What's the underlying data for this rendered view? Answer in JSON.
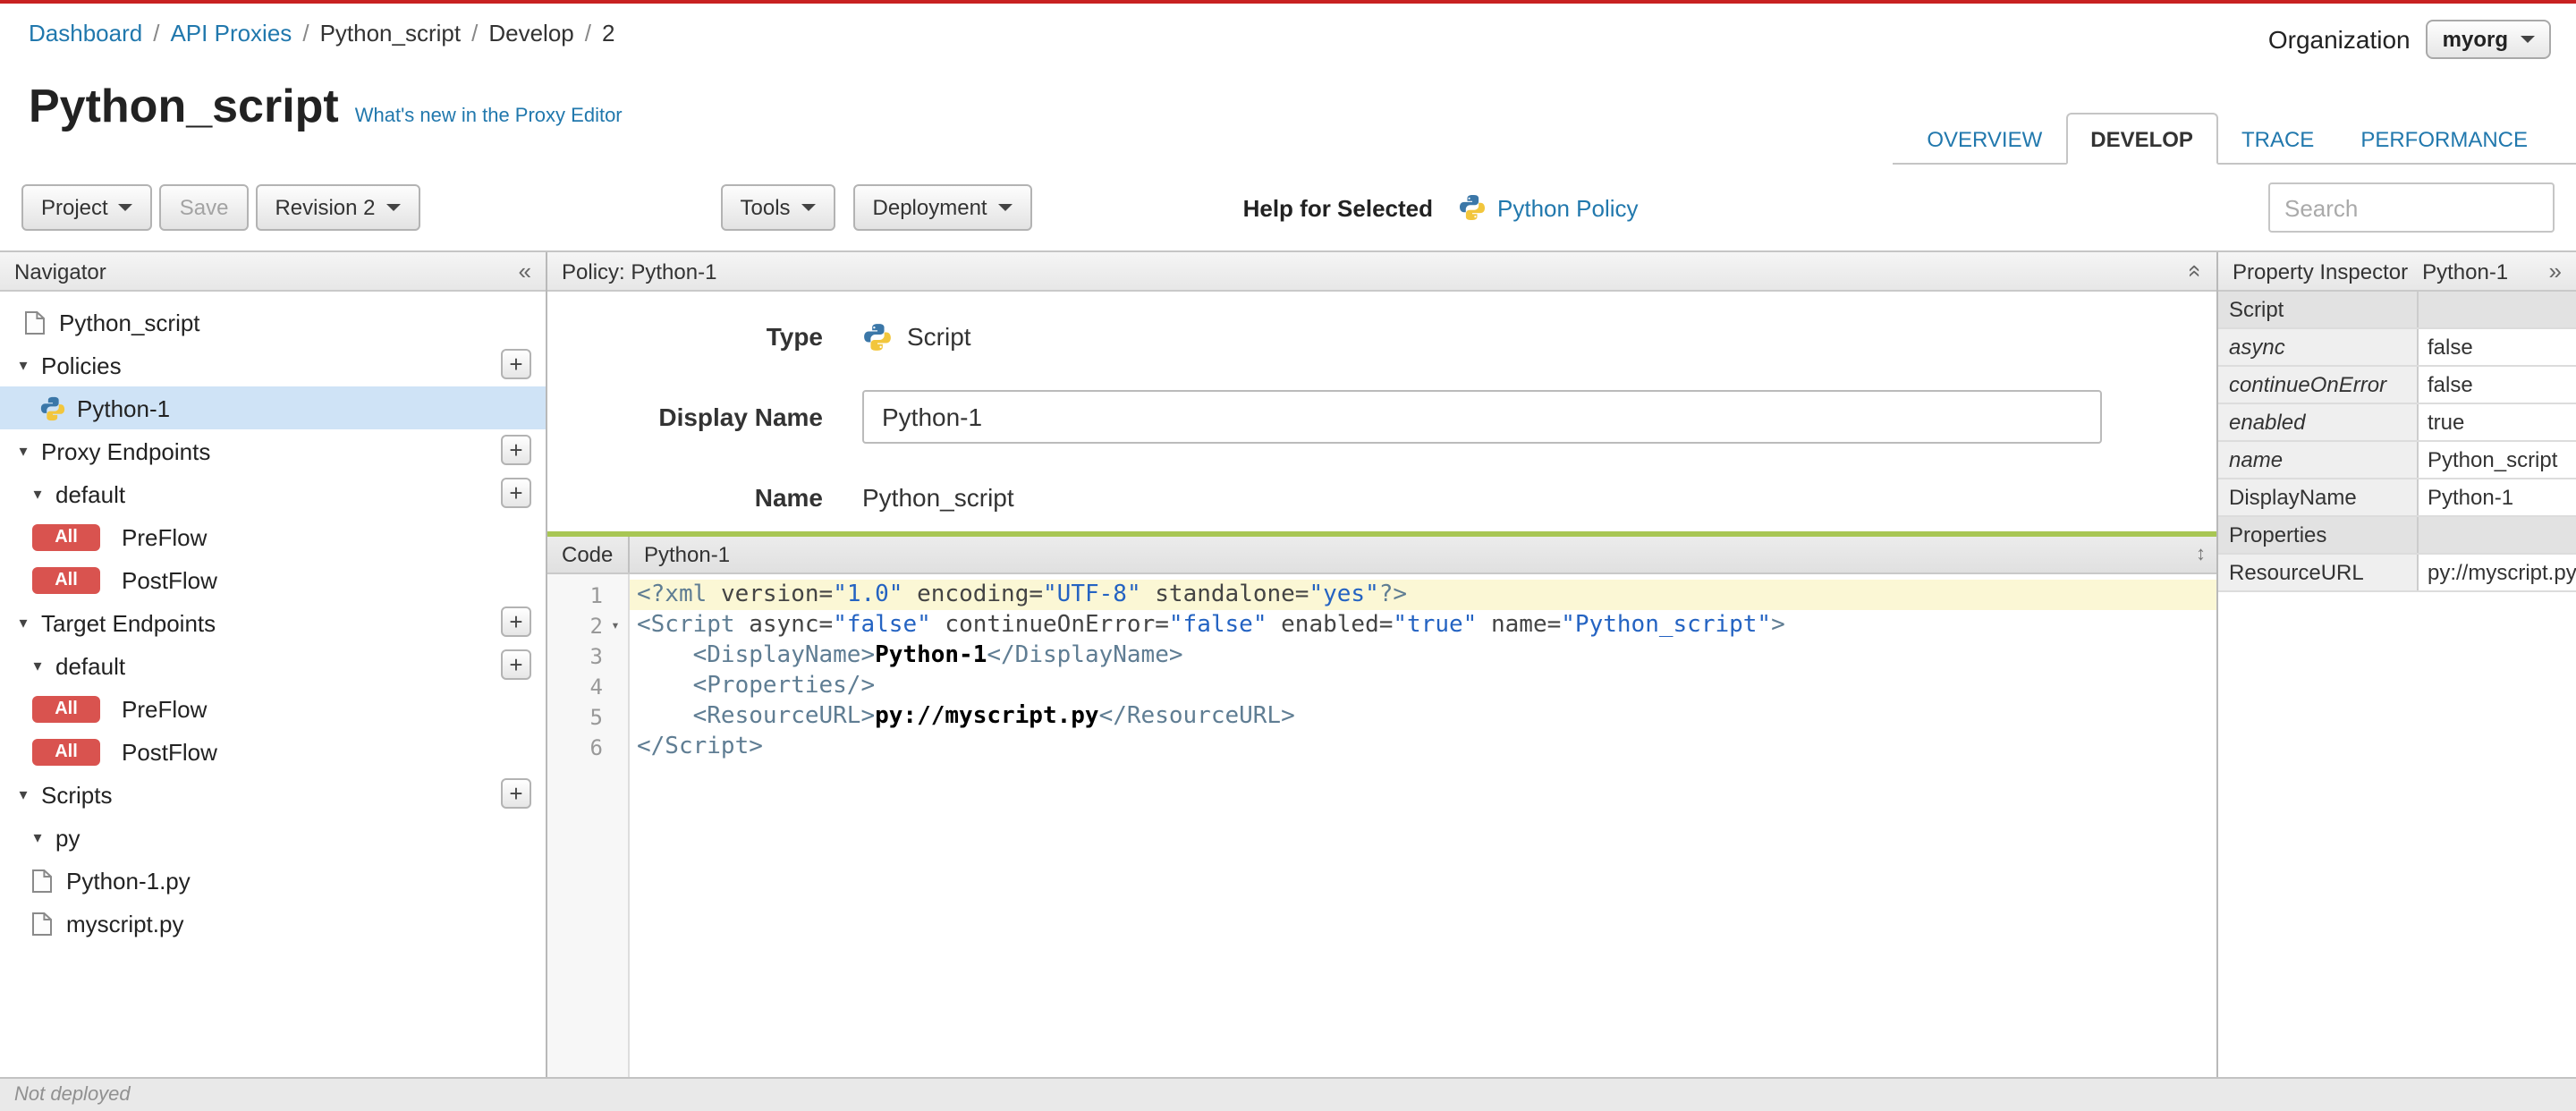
{
  "breadcrumb": {
    "separator": "/",
    "items": [
      "Dashboard",
      "API Proxies",
      "Python_script",
      "Develop",
      "2"
    ]
  },
  "organization": {
    "label": "Organization",
    "value": "myorg"
  },
  "header": {
    "title": "Python_script",
    "whats_new": "What's new in the Proxy Editor"
  },
  "tabs": {
    "items": [
      {
        "label": "OVERVIEW"
      },
      {
        "label": "DEVELOP"
      },
      {
        "label": "TRACE"
      },
      {
        "label": "PERFORMANCE"
      }
    ]
  },
  "toolbar": {
    "project": "Project",
    "save": "Save",
    "revision": "Revision 2",
    "tools": "Tools",
    "deployment": "Deployment",
    "help_for_selected": "Help for Selected",
    "python_policy": "Python Policy",
    "search_placeholder": "Search"
  },
  "navigator": {
    "title": "Navigator",
    "rows": [
      {
        "label": "Python_script"
      },
      {
        "label": "Policies"
      },
      {
        "label": "Python-1"
      },
      {
        "label": "Proxy Endpoints"
      },
      {
        "label": "default"
      },
      {
        "badge": "All",
        "label": "PreFlow"
      },
      {
        "badge": "All",
        "label": "PostFlow"
      },
      {
        "label": "Target Endpoints"
      },
      {
        "label": "default"
      },
      {
        "badge": "All",
        "label": "PreFlow"
      },
      {
        "badge": "All",
        "label": "PostFlow"
      },
      {
        "label": "Scripts"
      },
      {
        "label": "py"
      },
      {
        "label": "Python-1.py"
      },
      {
        "label": "myscript.py"
      }
    ]
  },
  "policy_panel": {
    "title": "Policy: Python-1",
    "type_label": "Type",
    "type_value": "Script",
    "display_name_label": "Display Name",
    "display_name_value": "Python-1",
    "name_label": "Name",
    "name_value": "Python_script"
  },
  "code": {
    "label": "Code",
    "tab": "Python-1",
    "lines": [
      {
        "n": 1,
        "highlight": true,
        "tokens": [
          [
            "tag",
            "<?xml "
          ],
          [
            "attr",
            "version="
          ],
          [
            "str",
            "\"1.0\""
          ],
          [
            "attr",
            " encoding="
          ],
          [
            "str",
            "\"UTF-8\""
          ],
          [
            "attr",
            " standalone="
          ],
          [
            "str",
            "\"yes\""
          ],
          [
            "tag",
            "?>"
          ]
        ]
      },
      {
        "n": 2,
        "fold": true,
        "tokens": [
          [
            "tag",
            "<Script "
          ],
          [
            "attr",
            "async="
          ],
          [
            "str",
            "\"false\""
          ],
          [
            "attr",
            " continueOnError="
          ],
          [
            "str",
            "\"false\""
          ],
          [
            "attr",
            " enabled="
          ],
          [
            "str",
            "\"true\""
          ],
          [
            "attr",
            " name="
          ],
          [
            "str",
            "\"Python_script\""
          ],
          [
            "tag",
            ">"
          ]
        ]
      },
      {
        "n": 3,
        "tokens": [
          [
            "plain",
            "    "
          ],
          [
            "tag",
            "<DisplayName>"
          ],
          [
            "txt",
            "Python-1"
          ],
          [
            "tag",
            "</DisplayName>"
          ]
        ]
      },
      {
        "n": 4,
        "tokens": [
          [
            "plain",
            "    "
          ],
          [
            "tag",
            "<Properties/>"
          ]
        ]
      },
      {
        "n": 5,
        "tokens": [
          [
            "plain",
            "    "
          ],
          [
            "tag",
            "<ResourceURL>"
          ],
          [
            "txt",
            "py://myscript.py"
          ],
          [
            "tag",
            "</ResourceURL>"
          ]
        ]
      },
      {
        "n": 6,
        "tokens": [
          [
            "tag",
            "</Script>"
          ]
        ]
      }
    ]
  },
  "inspector": {
    "title": "Property Inspector",
    "subtitle": "Python-1",
    "section": "Script",
    "rows": [
      {
        "label": "async",
        "value": "false"
      },
      {
        "label": "continueOnError",
        "value": "false"
      },
      {
        "label": "enabled",
        "value": "true"
      },
      {
        "label": "name",
        "value": "Python_script"
      },
      {
        "label": "DisplayName",
        "value": "Python-1"
      },
      {
        "label": "Properties",
        "value": ""
      },
      {
        "label": "ResourceURL",
        "value": "py://myscript.py"
      }
    ]
  },
  "statusbar": {
    "text": "Not deployed"
  },
  "icons": {
    "add": "+",
    "collapse_left": "«",
    "expand_right": "»",
    "caret": "▾",
    "resize": "↕"
  }
}
